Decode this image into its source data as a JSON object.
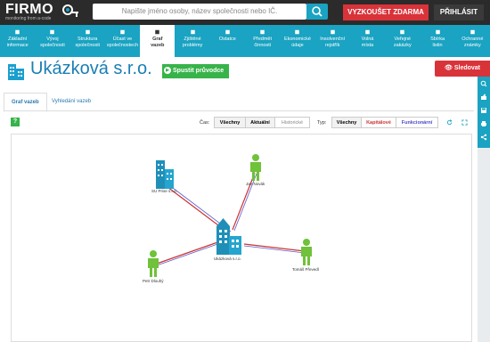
{
  "brand": {
    "name": "FIRMO",
    "tagline": "monitoring from a-code"
  },
  "search": {
    "placeholder": "Napište jméno osoby, název společnosti nebo IČ."
  },
  "actions": {
    "try_free": "VYZKOUŠET ZDARMA",
    "login": "PŘIHLÁSIT",
    "follow": "Sledovat",
    "guide": "Spustit průvodce"
  },
  "nav": [
    {
      "line1": "Základní",
      "line2": "informace",
      "icon": "home-icon"
    },
    {
      "line1": "Vývoj",
      "line2": "společnosti",
      "icon": "chart-icon"
    },
    {
      "line1": "Struktura",
      "line2": "společnosti",
      "icon": "structure-icon"
    },
    {
      "line1": "Účast ve",
      "line2": "společnostech",
      "icon": "people-icon"
    },
    {
      "line1": "Graf",
      "line2": "vazeb",
      "icon": "graph-icon"
    },
    {
      "line1": "Zjištěné",
      "line2": "problémy",
      "icon": "thumb-down-icon"
    },
    {
      "line1": "Ostatce",
      "line2": "",
      "icon": "moon-icon"
    },
    {
      "line1": "Předmět",
      "line2": "činnosti",
      "icon": "document-icon"
    },
    {
      "line1": "Ekonomické",
      "line2": "údaje",
      "icon": "pie-icon"
    },
    {
      "line1": "Insolvenční",
      "line2": "rejstřík",
      "icon": "shield-icon"
    },
    {
      "line1": "Volná",
      "line2": "místa",
      "icon": "pin-icon"
    },
    {
      "line1": "Veřejné",
      "line2": "zakázky",
      "icon": "car-icon"
    },
    {
      "line1": "Sbírka",
      "line2": "listin",
      "icon": "folder-icon"
    },
    {
      "line1": "Ochranné",
      "line2": "známky",
      "icon": "star-icon"
    }
  ],
  "company": {
    "name": "Ukázková s.r.o."
  },
  "tabs": {
    "graph": "Graf vazeb",
    "search": "Vyhledání vazeb"
  },
  "controls": {
    "time_label": "Čas:",
    "time_options": [
      "Všechny",
      "Aktuální",
      "Historické"
    ],
    "type_label": "Typ:",
    "type_options": [
      "Všechny",
      "Kapitálové",
      "Funkcionární"
    ]
  },
  "colors": {
    "accent": "#1aa3c2",
    "red": "#d9333a",
    "green": "#37b34a",
    "capital_link": "#cc3333",
    "functional_link": "#5a5acc"
  },
  "graph": {
    "nodes": [
      {
        "label": "Ukázková s.r.o.",
        "kind": "company"
      },
      {
        "label": "SU Prise s.r.o.",
        "kind": "company"
      },
      {
        "label": "Jan Novák",
        "kind": "person"
      },
      {
        "label": "Tomáš Převedl",
        "kind": "person"
      },
      {
        "label": "Petr Dlouhý",
        "kind": "person"
      }
    ]
  },
  "help": "?"
}
